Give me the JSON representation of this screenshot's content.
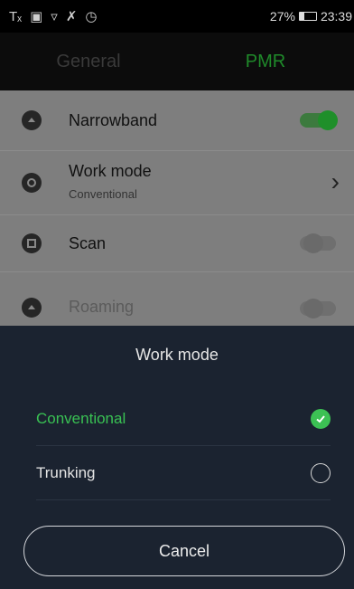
{
  "status_bar": {
    "icons": [
      "tx-icon",
      "sim-icon",
      "wifi-icon",
      "mute-icon",
      "alarm-icon"
    ],
    "battery_text": "27%",
    "battery_level": 0.27,
    "time": "23:39"
  },
  "tabs": [
    {
      "label": "General",
      "active": false
    },
    {
      "label": "PMR",
      "active": true
    }
  ],
  "settings": {
    "narrowband": {
      "label": "Narrowband",
      "icon": "radio-icon",
      "toggle_on": true
    },
    "work_mode": {
      "label": "Work mode",
      "value": "Conventional",
      "icon": "workmode-icon"
    },
    "scan": {
      "label": "Scan",
      "icon": "scan-icon",
      "toggle_on": false
    },
    "roaming": {
      "label": "Roaming",
      "icon": "roaming-icon",
      "toggle_on": false
    }
  },
  "dialog": {
    "title": "Work mode",
    "options": [
      {
        "label": "Conventional",
        "selected": true
      },
      {
        "label": "Trunking",
        "selected": false
      }
    ],
    "cancel_label": "Cancel"
  },
  "colors": {
    "accent_green": "#39c153",
    "dialog_bg": "#1b2330",
    "dim_overlay": "#7e7e7e"
  }
}
